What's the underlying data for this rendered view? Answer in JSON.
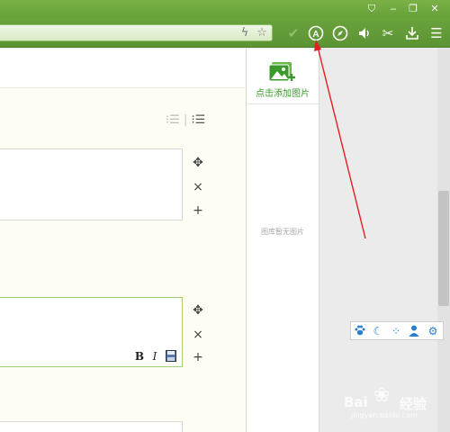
{
  "browser": {
    "window_buttons": [
      "shirt-icon",
      "minimize-icon",
      "restore-icon",
      "close-icon"
    ],
    "address_icons": [
      "lightning-icon",
      "star-icon"
    ],
    "toolbar_buttons": [
      "check-icon",
      "adblock-icon",
      "compass-icon",
      "volume-icon",
      "scissors-icon",
      "download-icon",
      "menu-icon"
    ],
    "accent": "#66a03a"
  },
  "editor": {
    "list_icons": [
      "ordered-list-icon",
      "unordered-list-icon"
    ],
    "format_buttons": {
      "bold": "B",
      "italic": "I"
    }
  },
  "image_panel": {
    "add_label": "点击添加图片",
    "empty_label": "图库暂无图片",
    "accent": "#3c9a2c"
  },
  "floating_toolbar": {
    "icons": [
      "paw-icon",
      "moon-icon",
      "dots-icon",
      "user-icon",
      "gear-icon"
    ],
    "color": "#2a7fd0"
  },
  "watermark": {
    "brand": "Bai",
    "suffix": "经验",
    "url": "jingyan.baidu.com"
  },
  "annotation": {
    "color": "#e02020"
  }
}
